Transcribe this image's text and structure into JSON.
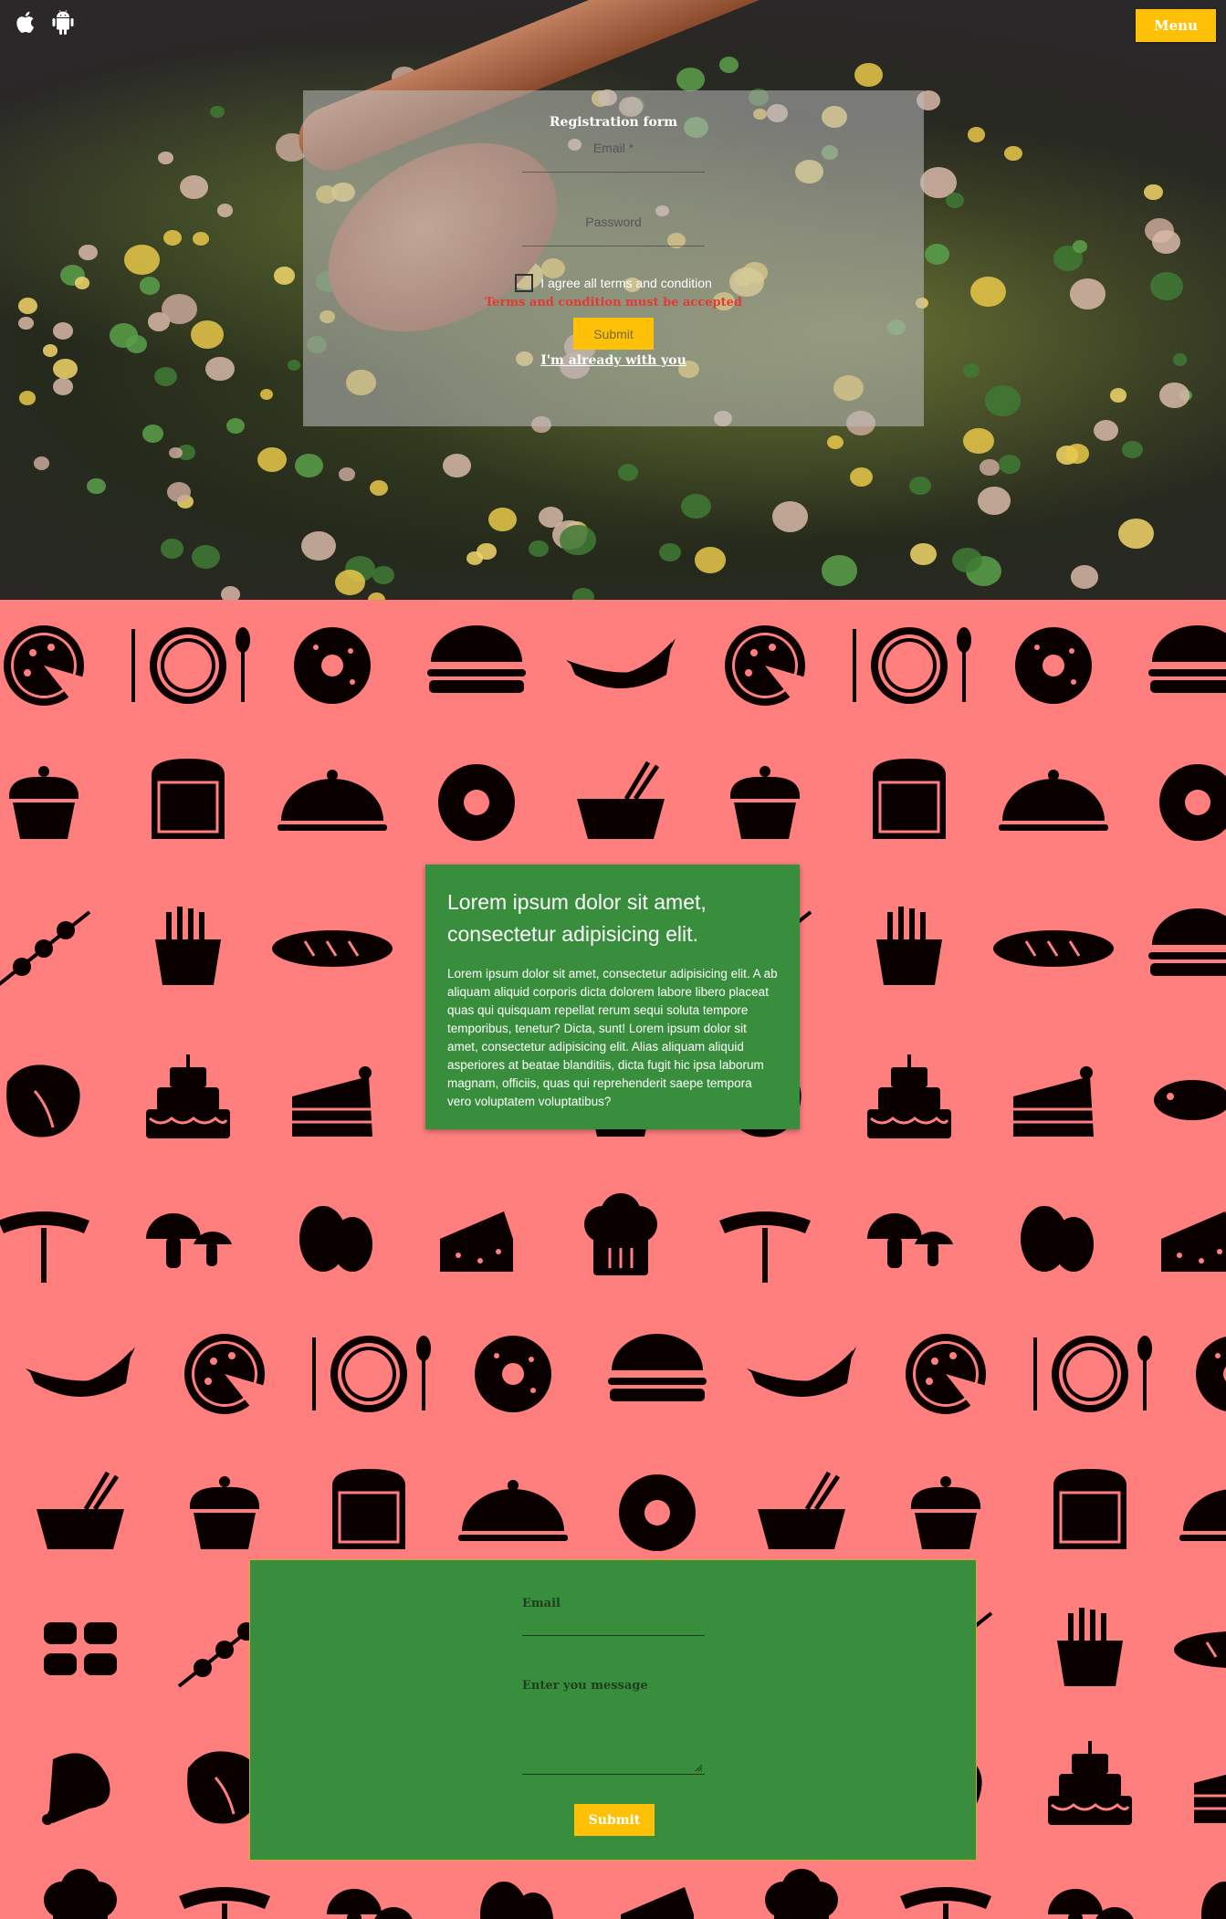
{
  "header": {
    "platform_icons": [
      "apple-icon",
      "android-icon"
    ],
    "menu_label": "Menu"
  },
  "registration": {
    "title": "Registration form",
    "email_placeholder": "Email *",
    "password_placeholder": "Password",
    "agree_label": "I agree all terms and condition",
    "agree_checked": false,
    "error_text": "Terms and condition must be accepted",
    "submit_label": "Submit",
    "login_link": "I'm already with you"
  },
  "info_card": {
    "title": "Lorem ipsum dolor sit amet, consectetur adipisicing elit.",
    "body": "Lorem ipsum dolor sit amet, consectetur adipisicing elit. A ab aliquam aliquid corporis dicta dolorem labore libero placeat quas qui quisquam repellat rerum sequi soluta tempore temporibus, tenetur? Dicta, sunt! Lorem ipsum dolor sit amet, consectetur adipisicing elit. Alias aliquam aliquid asperiores at beatae blanditiis, dicta fugit hic ipsa laborum magnam, officiis, quas qui reprehenderit saepe tempora vero voluptatem voluptatibus?"
  },
  "contact": {
    "email_label": "Email",
    "message_label": "Enter you message",
    "submit_label": "Submit"
  },
  "colors": {
    "accent": "#ffc107",
    "green": "#388e3c",
    "pattern_bg": "#ff7f7f",
    "error": "#e53935"
  },
  "pattern_icons": [
    "pizza-icon",
    "plate-icon",
    "donut-icon",
    "burger-icon",
    "croissant-icon",
    "cupcake-icon",
    "bread-icon",
    "cloche-icon",
    "egg-icon",
    "bowl-icon",
    "skewer-icon",
    "fries-icon",
    "baguette-icon",
    "steak-icon",
    "cake-icon",
    "cake-slice-icon",
    "fish-icon",
    "sausage-icon",
    "mushroom-icon",
    "eggs-icon",
    "cheese-icon",
    "chef-hat-icon",
    "sushi-icon",
    "chicken-leg-icon"
  ]
}
